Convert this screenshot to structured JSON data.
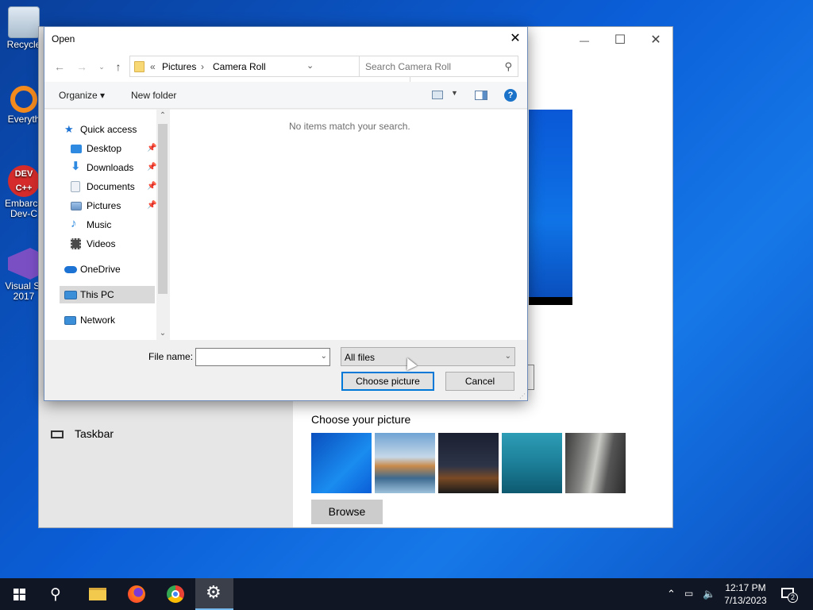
{
  "desktop": {
    "icons": [
      {
        "label": "Recycle",
        "icon": "recycle-bin-icon"
      },
      {
        "label": "Everyth",
        "icon": "everything-search-icon"
      },
      {
        "label": "Embarca Dev-C",
        "icon": "dev-cpp-icon",
        "glyph": "DEV C++"
      },
      {
        "label": "Visual St 2017",
        "icon": "visual-studio-icon"
      }
    ]
  },
  "settings": {
    "choose_picture_label": "Choose your picture",
    "browse_label": "Browse",
    "taskbar_label": "Taskbar",
    "window_controls": {
      "minimize": "—",
      "maximize": "☐",
      "close": "✕"
    }
  },
  "dialog": {
    "title": "Open",
    "close_glyph": "✕",
    "address": {
      "overflow": "«",
      "crumbs": [
        "Pictures",
        "Camera Roll"
      ],
      "separator": "›"
    },
    "search_placeholder": "Search Camera Roll",
    "toolbar": {
      "organize": "Organize ▾",
      "new_folder": "New folder",
      "help": "?"
    },
    "nav_items": [
      {
        "label": "Quick access",
        "icon": "star-icon",
        "color": "#1c73d4",
        "pinned": false
      },
      {
        "label": "Desktop",
        "icon": "desktop-icon",
        "color": "#2d8ae0",
        "pinned": true
      },
      {
        "label": "Downloads",
        "icon": "downloads-icon",
        "color": "#2d8ae0",
        "pinned": true
      },
      {
        "label": "Documents",
        "icon": "documents-icon",
        "color": "#b9c4cf",
        "pinned": true
      },
      {
        "label": "Pictures",
        "icon": "pictures-icon",
        "color": "#7aa7d6",
        "pinned": true
      },
      {
        "label": "Music",
        "icon": "music-icon",
        "color": "#2d8ae0",
        "pinned": false
      },
      {
        "label": "Videos",
        "icon": "videos-icon",
        "color": "#4a4a4a",
        "pinned": false
      },
      {
        "label": "OneDrive",
        "icon": "onedrive-icon",
        "color": "#1c73d4",
        "pinned": false
      },
      {
        "label": "This PC",
        "icon": "this-pc-icon",
        "color": "#3b8fd9",
        "pinned": false,
        "selected": true
      },
      {
        "label": "Network",
        "icon": "network-icon",
        "color": "#3b8fd9",
        "pinned": false
      }
    ],
    "empty_message": "No items match your search.",
    "file_name_label": "File name:",
    "file_name_value": "",
    "file_type": "All files",
    "choose_button": "Choose picture",
    "cancel_button": "Cancel"
  },
  "taskbar": {
    "time": "12:17 PM",
    "date": "7/13/2023",
    "notification_count": "2"
  },
  "colors": {
    "accent": "#0078d7",
    "desktop_blue": "#0b5ed7",
    "taskbar": "#101623"
  }
}
